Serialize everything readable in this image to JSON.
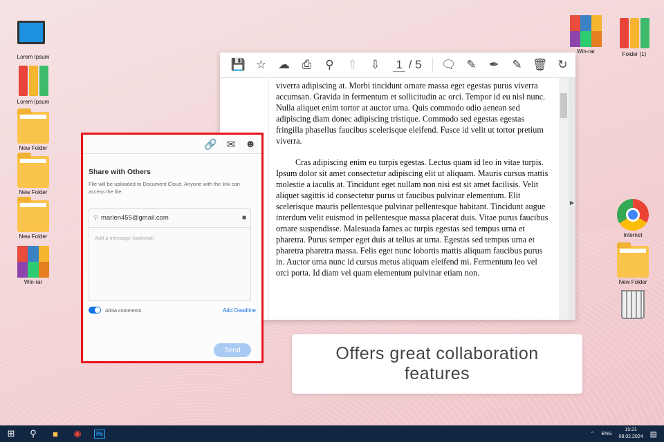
{
  "desktop": {
    "left": [
      "Lorem Ipsum",
      "Lorem Ipsum",
      "New Folder",
      "New Folder",
      "New Folder",
      "Win-rar"
    ],
    "right_top": [
      "Win-rar",
      "Folder (1)"
    ],
    "right": [
      "Internet",
      "New Folder"
    ]
  },
  "viewer": {
    "page_current": "1",
    "page_total": "/ 5",
    "paragraphs": [
      "viverra adipiscing at. Morbi tincidunt ornare massa eget egestas purus viverra accumsan. Gravida in fermentum et sollicitudin ac orci. Tempor id eu nisl nunc. Nulla aliquet enim tortor at auctor urna. Quis commodo odio aenean sed adipiscing diam donec adipiscing tristique. Commodo sed egestas egestas fringilla phasellus faucibus scelerisque eleifend. Fusce id velit ut tortor pretium viverra.",
      "Cras adipiscing enim eu turpis egestas. Lectus quam id leo in vitae turpis. Ipsum dolor sit amet consectetur adipiscing elit ut aliquam. Mauris cursus mattis molestie a iaculis at. Tincidunt eget nullam non nisi est sit amet facilisis. Velit aliquet sagittis id consectetur purus ut faucibus pulvinar elementum. Elit scelerisque mauris pellentesque pulvinar pellentesque habitant. Tincidunt augue interdum velit euismod in pellentesque massa placerat duis. Vitae purus faucibus ornare suspendisse. Malesuada fames ac turpis egestas sed tempus urna et pharetra. Purus semper eget duis at tellus at urna. Egestas sed tempus urna et pharetra pharetra massa. Felis eget nunc lobortis mattis aliquam faucibus purus in. Auctor urna nunc id cursus metus aliquam eleifend mi. Fermentum leo vel orci porta. Id diam vel quam elementum pulvinar etiam non."
    ]
  },
  "share": {
    "title": "Share with Others",
    "description": "File will be uploaded to Document Cloud. Anyone with the link can access the file.",
    "email_value": "marlen455@gmail.com",
    "message_placeholder": "Add a message (optional)",
    "allow_comments": "Allow comments",
    "allow_comments_on": true,
    "add_deadline": "Add Deadline",
    "send": "Send"
  },
  "caption": "Offers great collaboration features",
  "taskbar": {
    "lang": "ENG",
    "time": "15:21",
    "date": "08.02.2024"
  }
}
